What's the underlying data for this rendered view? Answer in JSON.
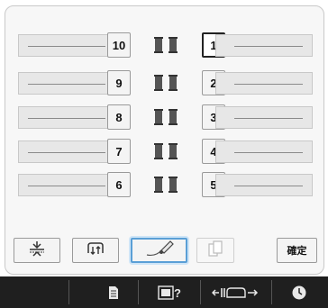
{
  "needle_bars": {
    "left": [
      "10",
      "9",
      "8",
      "7",
      "6"
    ],
    "right": [
      "1",
      "2",
      "3",
      "4",
      "5"
    ],
    "selected": "1"
  },
  "toolbar": {
    "buttons": [
      {
        "name": "embroidery-position-button",
        "icon": "needle-guide-icon"
      },
      {
        "name": "thread-change-button",
        "icon": "thread-spool-icon"
      },
      {
        "name": "thread-setting-button",
        "icon": "needle-thread-icon",
        "active": true
      },
      {
        "name": "copy-button",
        "icon": "copy-icon",
        "disabled": true
      }
    ],
    "ok_label": "確定"
  },
  "statusbar": {
    "icons": [
      "document-icon",
      "help-icon",
      "bobbin-move-icon",
      "clock-icon"
    ]
  }
}
